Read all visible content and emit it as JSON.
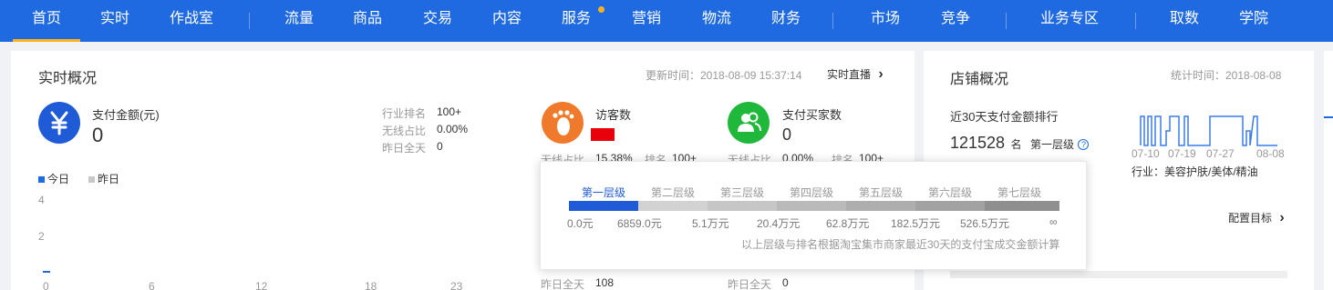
{
  "nav": {
    "items": [
      "首页",
      "实时",
      "作战室",
      "流量",
      "商品",
      "交易",
      "内容",
      "服务",
      "营销",
      "物流",
      "财务",
      "市场",
      "竞争",
      "业务专区",
      "取数",
      "学院"
    ]
  },
  "realtime": {
    "title": "实时概况",
    "updated": "更新时间：2018-08-09 15:37:14",
    "live_link": "实时直播",
    "live_chevron": "›",
    "pay_amount": {
      "label": "支付金额(元)",
      "value": "0",
      "stats": [
        {
          "label": "行业排名",
          "value": "100+"
        },
        {
          "label": "无线占比",
          "value": "0.00%"
        },
        {
          "label": "昨日全天",
          "value": "0"
        }
      ]
    },
    "visitors": {
      "label": "访客数",
      "partial_left": "无线占比",
      "partial_left_value": "15.38%",
      "partial_right": "排名",
      "partial_right_value": "100+",
      "yesterday_label": "昨日全天",
      "yesterday_value": "108"
    },
    "buyers": {
      "label": "支付买家数",
      "value": "0",
      "partial_left": "无线占比",
      "partial_left_value": "0.00%",
      "partial_right": "排名",
      "partial_right_value": "100+",
      "yesterday_label": "昨日全天",
      "yesterday_value": "0"
    },
    "legend": {
      "today": "今日",
      "yesterday": "昨日"
    }
  },
  "chart_data": {
    "type": "line",
    "x_ticks": [
      "0",
      "6",
      "12",
      "18",
      "23"
    ],
    "y_ticks": [
      "4",
      "2"
    ],
    "series": [
      {
        "name": "今日",
        "color": "#1f6ae0"
      },
      {
        "name": "昨日",
        "color": "#c8c8c8"
      }
    ]
  },
  "popup": {
    "levels": [
      "第一层级",
      "第二层级",
      "第三层级",
      "第四层级",
      "第五层级",
      "第六层级",
      "第七层级"
    ],
    "ticks": [
      "0.0元",
      "6859.0元",
      "5.1万元",
      "20.4万元",
      "62.8万元",
      "182.5万元",
      "526.5万元",
      "∞"
    ],
    "note": "以上层级与排名根据淘宝集市商家最近30天的支付宝成交金额计算",
    "colors": [
      "#1f5bd6",
      "#d2d2d2",
      "#c6c6c6",
      "#bababa",
      "#aeaeae",
      "#a2a2a2",
      "#8f8f8f"
    ]
  },
  "store": {
    "title": "店铺概况",
    "stat_time": "统计时间：2018-08-08",
    "rank_title": "近30天支付金额排行",
    "rank_value": "121528",
    "rank_unit": "名",
    "level": "第一层级",
    "info": "?",
    "sparkline_dates": [
      "07-10",
      "07-19",
      "07-27",
      "08-08"
    ],
    "industry": "行业：美容护肤/美体/精油",
    "config_link": "配置目标",
    "config_chevron": "›"
  }
}
